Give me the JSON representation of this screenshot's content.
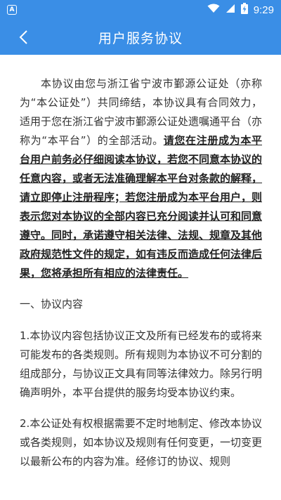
{
  "status_bar": {
    "app_badge": "A",
    "time": "9:29",
    "icons": [
      "wifi-icon",
      "signal-icon",
      "battery-icon"
    ]
  },
  "nav": {
    "title": "用户服务协议",
    "back_icon": "chevron-left-icon"
  },
  "content": {
    "intro_plain": "本协议由您与浙江省宁波市鄞源公证处（亦称为“本公证处”）共同缔结，本协议具有合同效力，适用于您在浙江省宁波市鄞源公证处遗嘱通平台（亦称为“本平台”）的全部活动。",
    "intro_emphasis": "请您在注册成为本平台用户前务必仔细阅读本协议，若您不同意本协议的任意内容，或者无法准确理解本平台对条款的解释，请立即停止注册程序；若您注册成为本平台用户，则表示您对本协议的全部内容已充分阅读并认可和同意遵守。同时，承诺遵守相关法律、法规、规章及其他政府规范性文件的规定，如有违反而造成任何法律后果，您将承担所有相应的法律责任。",
    "section1_title": "一、协议内容",
    "item1": "1.本协议内容包括协议正文及所有已经发布的或将来可能发布的各类规则。所有规则为本协议不可分割的组成部分，与协议正文具有同等法律效力。除另行明确声明外，本平台提供的服务均受本协议约束。",
    "item2": "2.本公证处有权根据需要不定时地制定、修改本协议或各类规则，如本协议及规则有任何变更，一切变更以最新公布的内容为准。经修订的协议、规则"
  },
  "colors": {
    "header_bg": "#3a8ee6",
    "header_text": "#ffffff",
    "body_text": "#333333"
  }
}
